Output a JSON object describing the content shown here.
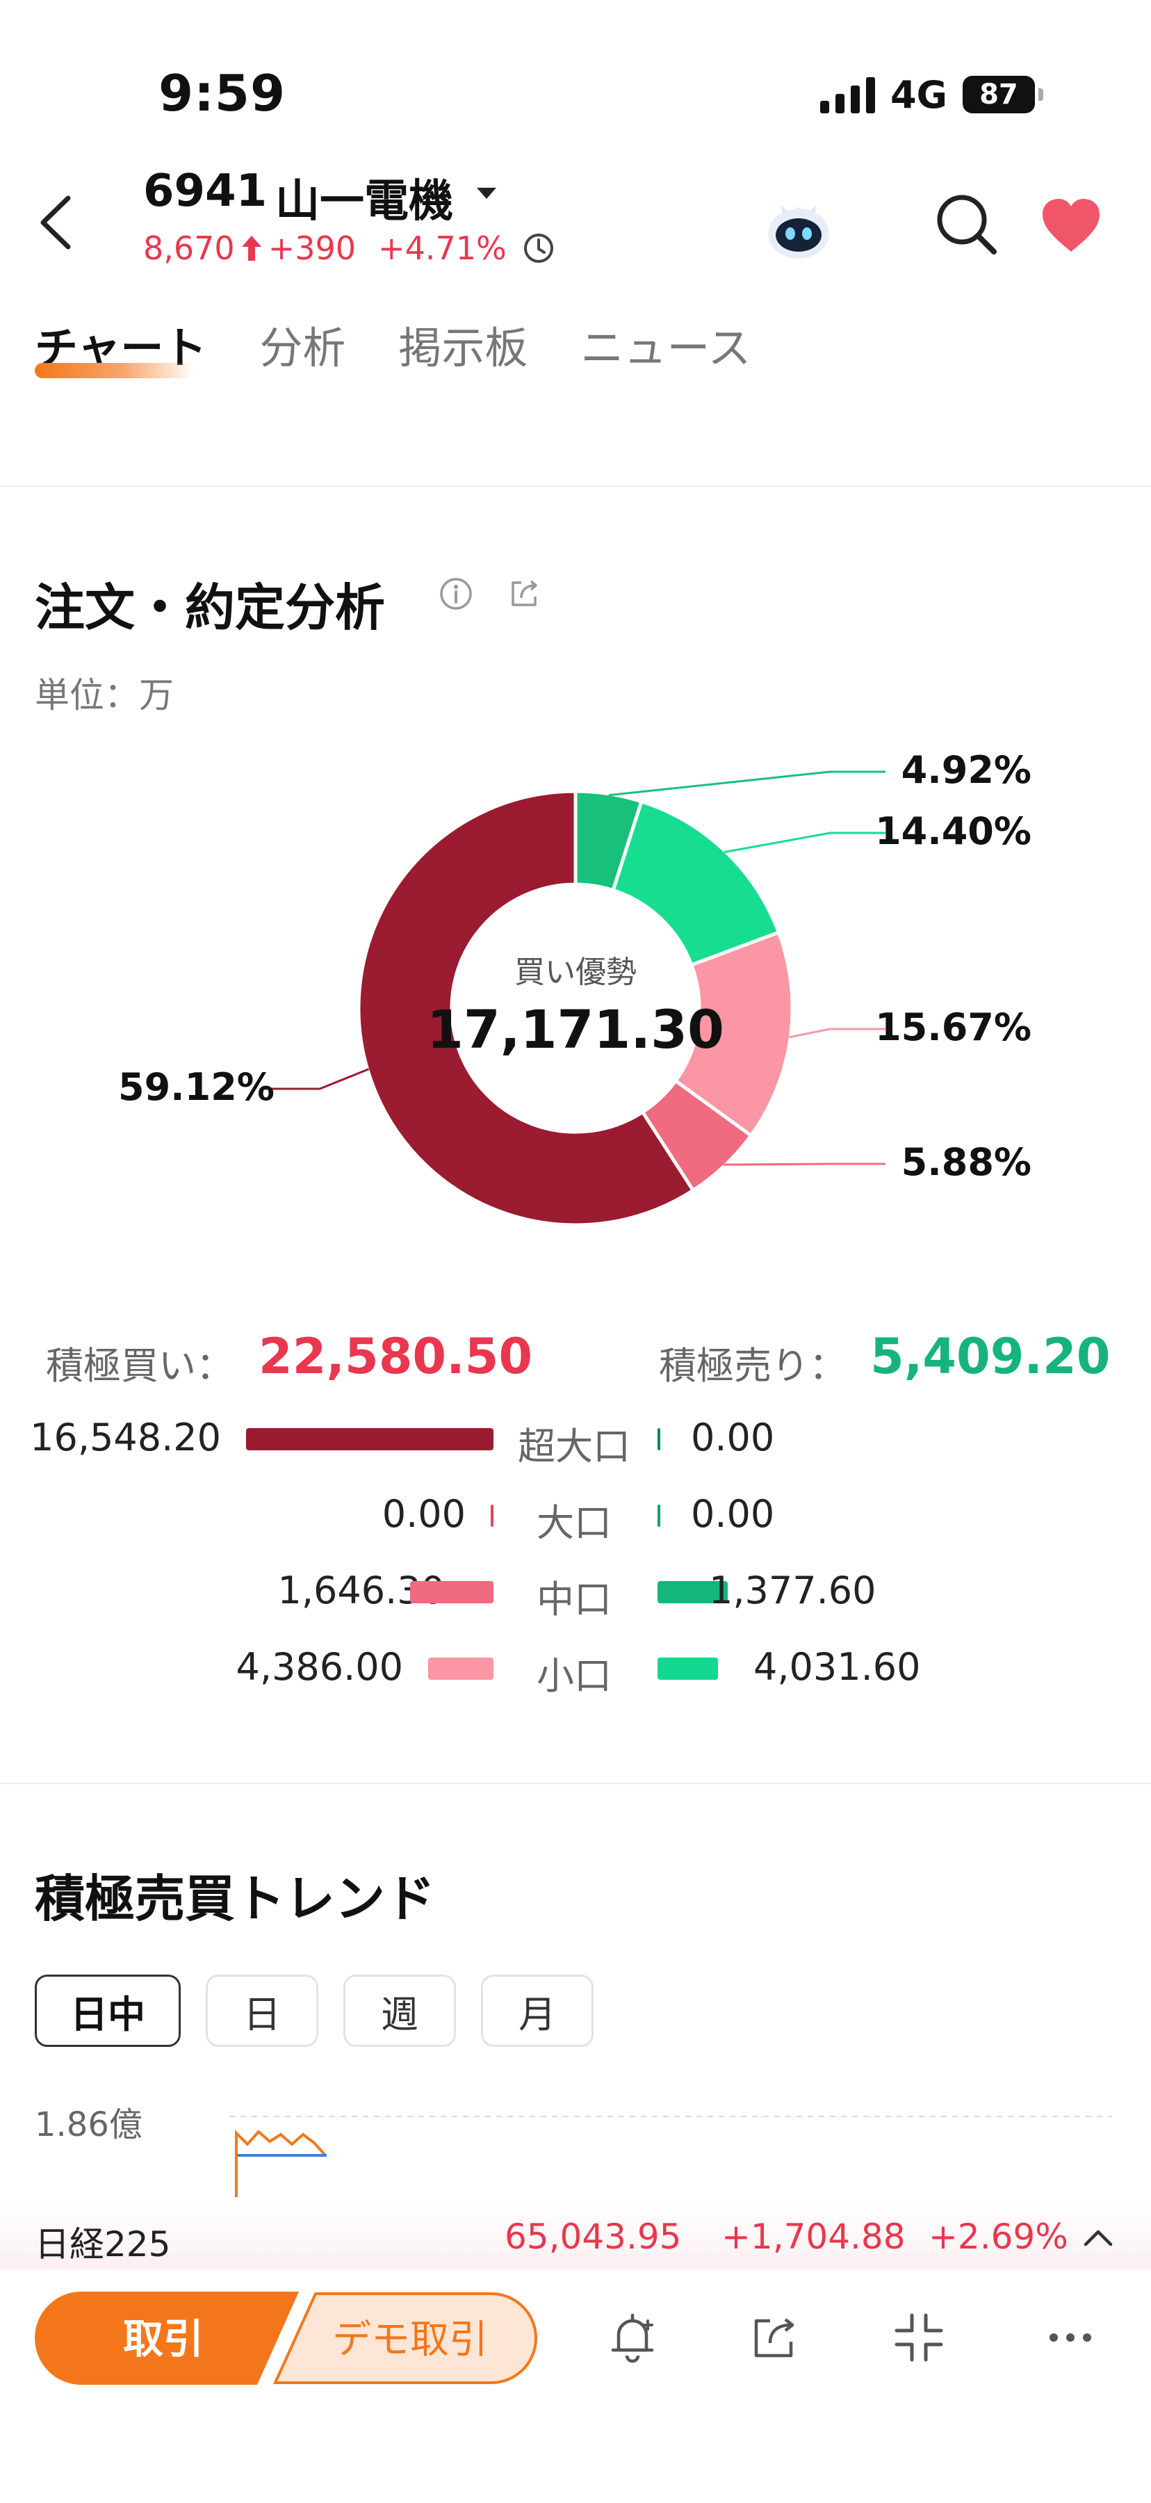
{
  "status_bar": {
    "time": "9:59",
    "network": "4G",
    "battery": "87"
  },
  "header": {
    "stock_code": "6941",
    "stock_name": "山一電機",
    "price": "8,670",
    "change": "+390",
    "change_pct": "+4.71%"
  },
  "tabs": [
    {
      "label": "チャート",
      "active": true
    },
    {
      "label": "分析",
      "active": false
    },
    {
      "label": "掲示板",
      "active": false
    },
    {
      "label": "ニュース",
      "active": false
    }
  ],
  "order_analysis": {
    "title": "注文・約定分析",
    "unit": "単位：万",
    "center_label": "買い優勢",
    "center_value": "17,171.30",
    "buy_total_label": "積極買い：",
    "buy_total": "22,580.50",
    "sell_total_label": "積極売り：",
    "sell_total": "5,409.20",
    "rows": [
      {
        "category": "超大口",
        "buy": "16,548.20",
        "sell": "0.00",
        "buy_value": 16548.2,
        "sell_value": 0.0,
        "buy_color": "#9b1b30",
        "sell_color": "#0f8a5f"
      },
      {
        "category": "大口",
        "buy": "0.00",
        "sell": "0.00",
        "buy_value": 0.0,
        "sell_value": 0.0,
        "buy_color": "#d9475d",
        "sell_color": "#12a06c"
      },
      {
        "category": "中口",
        "buy": "1,646.30",
        "sell": "1,377.60",
        "buy_value": 1646.3,
        "sell_value": 1377.6,
        "buy_color": "#f06a80",
        "sell_color": "#13b77b"
      },
      {
        "category": "小口",
        "buy": "4,386.00",
        "sell": "4,031.60",
        "buy_value": 4386.0,
        "sell_value": 4031.6,
        "buy_color": "#fb96a4",
        "sell_color": "#12d98f"
      }
    ]
  },
  "chart_data": {
    "type": "pie",
    "title": "注文・約定分析",
    "center_label": "買い優勢",
    "center_value": "17,171.30",
    "slices": [
      {
        "label": "4.92%",
        "value": 4.92,
        "color": "#18c07c"
      },
      {
        "label": "14.40%",
        "value": 14.4,
        "color": "#16dd8f"
      },
      {
        "label": "15.67%",
        "value": 15.67,
        "color": "#fb96a4"
      },
      {
        "label": "5.88%",
        "value": 5.88,
        "color": "#f06a80"
      },
      {
        "label": "59.12%",
        "value": 59.12,
        "color": "#9b1b30"
      }
    ]
  },
  "trend": {
    "title": "積極売買トレンド",
    "periods": [
      {
        "label": "日中",
        "active": true
      },
      {
        "label": "日",
        "active": false
      },
      {
        "label": "週",
        "active": false
      },
      {
        "label": "月",
        "active": false
      }
    ],
    "axis_top": "1.86億"
  },
  "ticker": {
    "name": "日経225",
    "price": "65,043.95",
    "change": "+1,704.88",
    "change_pct": "+2.69%"
  },
  "bottom_bar": {
    "trade_label": "取引",
    "demo_label": "デモ取引",
    "accent": "#f3771a"
  }
}
